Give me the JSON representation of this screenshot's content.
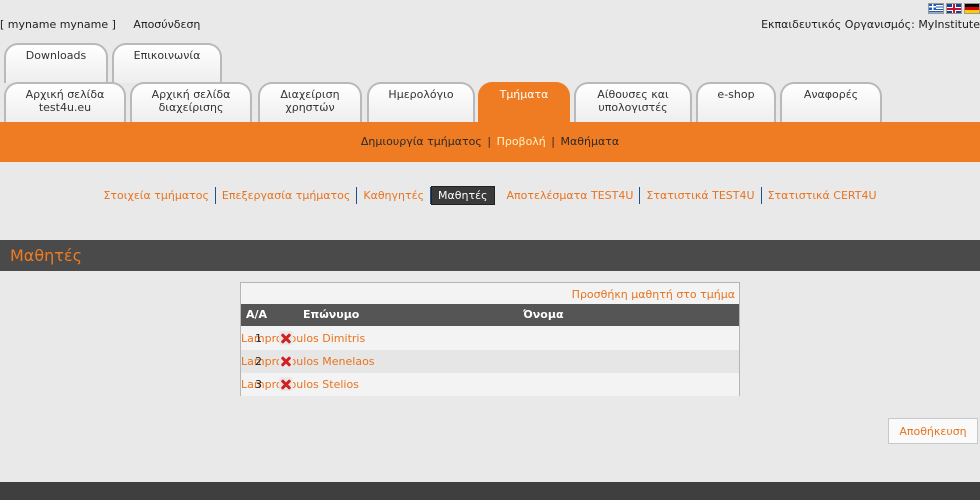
{
  "header": {
    "user_label": "[ myname myname ]",
    "logout": "Αποσύνδεση",
    "organization": "Εκπαιδευτικός Οργανισμός: MyInstitute",
    "flags": [
      "greek-flag-icon",
      "uk-flag-icon",
      "german-flag-icon"
    ]
  },
  "tabs_top": [
    "Downloads",
    "Επικοινωνία"
  ],
  "tabs_main": [
    "Αρχική σελίδα test4u.eu",
    "Αρχική σελίδα διαχείρισης",
    "Διαχείριση χρηστών",
    "Ημερολόγιο",
    "Τμήματα",
    "Αίθουσες και υπολογιστές",
    "e-shop",
    "Αναφορές"
  ],
  "active_tab": "Τμήματα",
  "submenu": {
    "create": "Δημιουργία τμήματος",
    "view": "Προβολή",
    "courses": "Μαθήματα",
    "separator": "|"
  },
  "section_nav": [
    "Στοιχεία τμήματος",
    "Επεξεργασία τμήματος",
    "Καθηγητές",
    "Μαθητές",
    "Αποτελέσματα TEST4U",
    "Στατιστικά TEST4U",
    "Στατιστικά CERT4U"
  ],
  "section_nav_active": "Μαθητές",
  "section_title": "Μαθητές",
  "students": {
    "add_link": "Προσθήκη μαθητή στο τμήμα",
    "columns": [
      "Α/Α",
      "Επώνυμο",
      "Όνομα"
    ],
    "rows": [
      {
        "num": "1",
        "last_name": "Lampropoulos",
        "first_name": "Dimitris"
      },
      {
        "num": "2",
        "last_name": "Lampropoulos",
        "first_name": "Menelaos"
      },
      {
        "num": "3",
        "last_name": "Lampropoulos",
        "first_name": "Stelios"
      }
    ],
    "delete_icon": "delete-x-icon"
  },
  "save_button": "Αποθήκευση",
  "colors": {
    "accent": "#ef7b22",
    "link": "#e8731f",
    "dark_bar": "#4a4a4a",
    "background": "#e9e9e9"
  }
}
